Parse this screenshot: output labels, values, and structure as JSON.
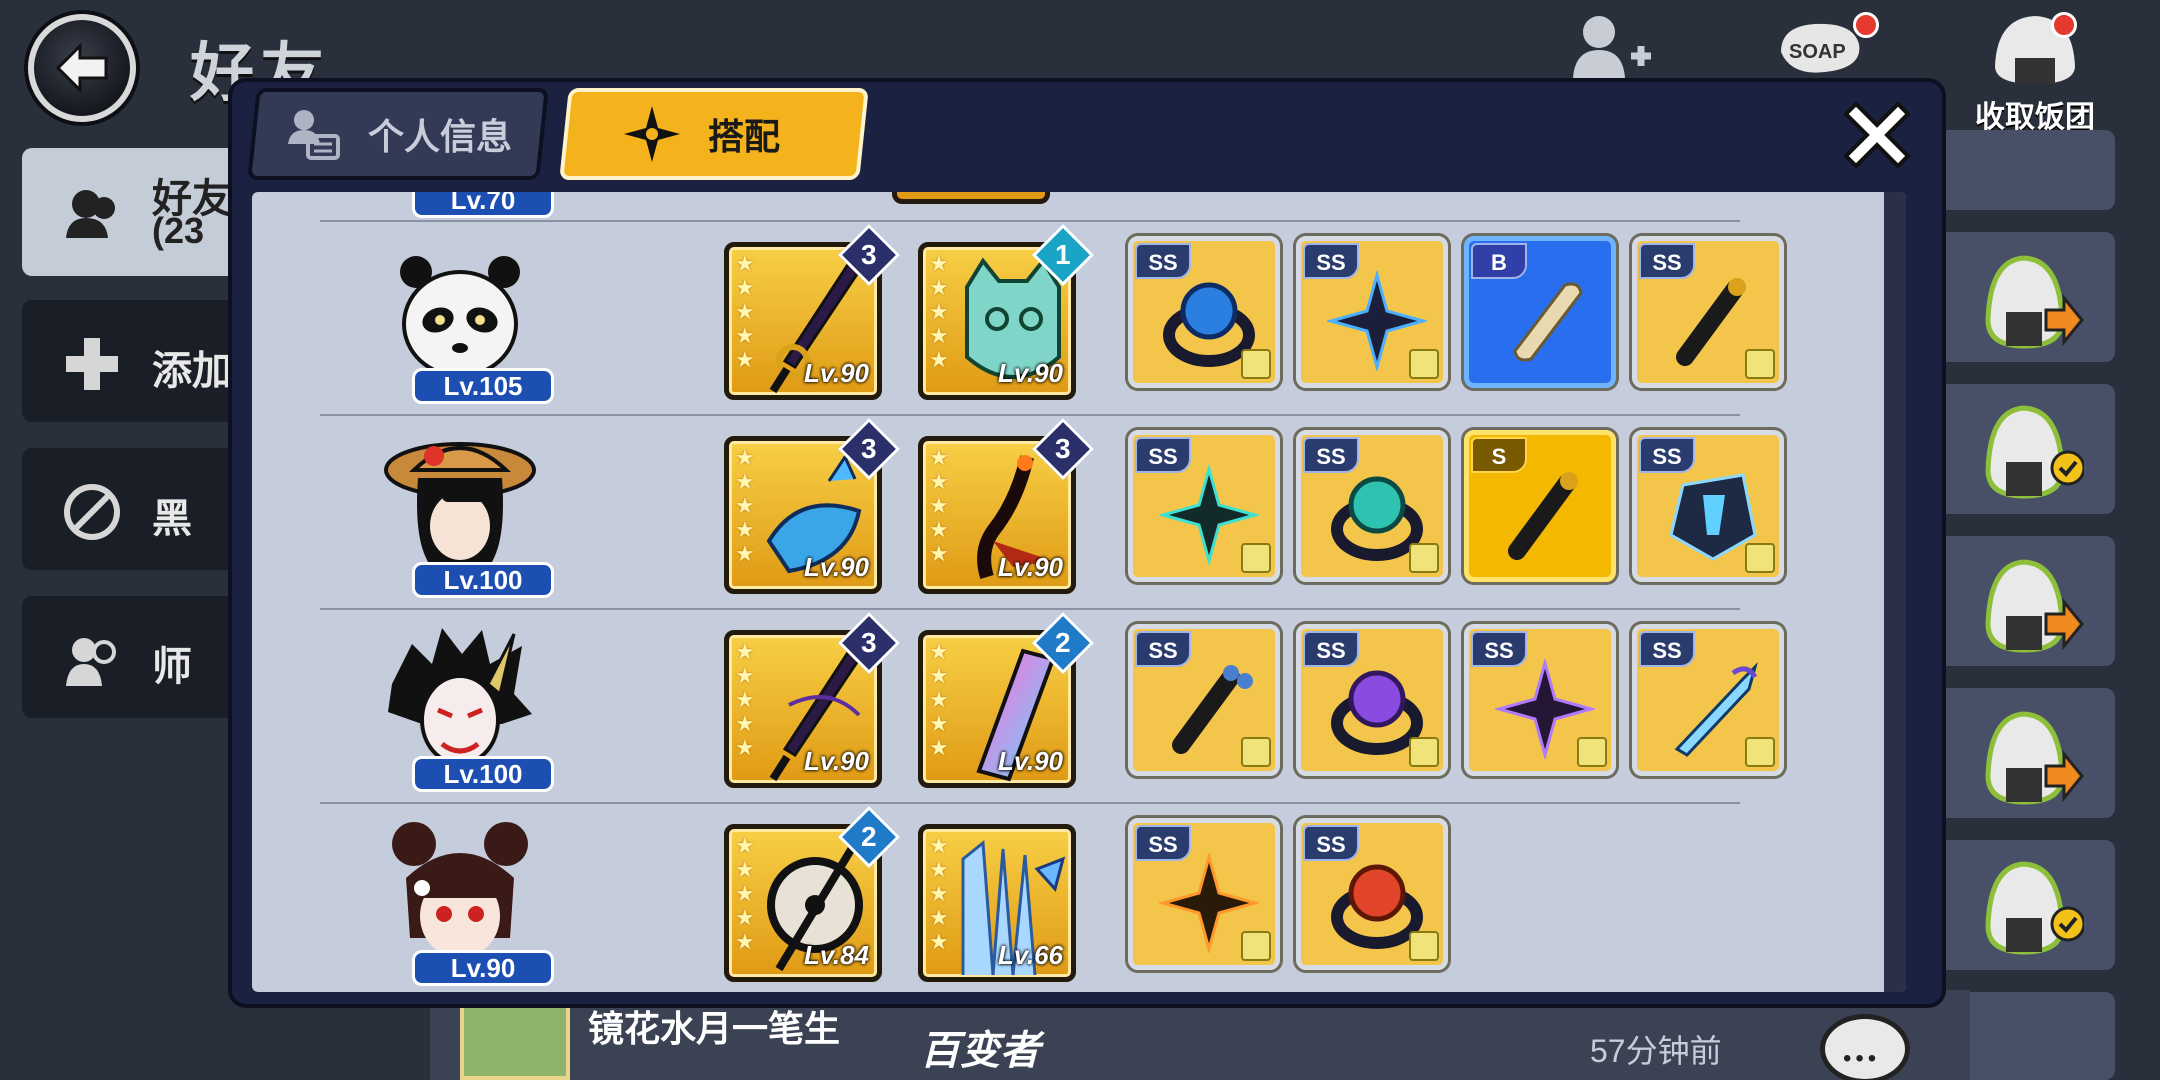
{
  "background": {
    "title": "好友",
    "side": [
      {
        "label": "好友",
        "sub": "(23",
        "icon": "friends-icon"
      },
      {
        "label": "添加",
        "icon": "plus-icon"
      },
      {
        "label": "黑",
        "icon": "block-icon"
      },
      {
        "label": "师",
        "icon": "mentor-icon"
      }
    ],
    "top_right": [
      {
        "icon": "add-friend-icon",
        "label": ""
      },
      {
        "icon": "soap-icon",
        "label": ""
      },
      {
        "icon": "onigiri-icon",
        "label": "收取饭团"
      }
    ],
    "bottom_name": "镜花水月一笔生",
    "bottom_tag": "百变者",
    "bottom_time": "57分钟前"
  },
  "modal": {
    "tabs": [
      {
        "label": "个人信息",
        "active": false,
        "icon": "profile-card-icon"
      },
      {
        "label": "搭配",
        "active": true,
        "icon": "shuriken-icon"
      }
    ],
    "prev_level": "Lv.70",
    "rows": [
      {
        "character": "panda-ninja",
        "level": "Lv.105",
        "weapons": [
          {
            "stars": 5,
            "level": "Lv.90",
            "badge": "3",
            "art": "dark-katana"
          },
          {
            "stars": 5,
            "level": "Lv.90",
            "badge": "1",
            "art": "cat-mask"
          }
        ],
        "scrolls": [
          {
            "grade": "SS",
            "art": "ring-blue"
          },
          {
            "grade": "SS",
            "art": "shuriken-blue"
          },
          {
            "grade": "B",
            "art": "paper-scroll",
            "tier": "blue"
          },
          {
            "grade": "SS",
            "art": "scroll-black"
          }
        ]
      },
      {
        "character": "straw-hat-girl",
        "level": "Lv.100",
        "weapons": [
          {
            "stars": 5,
            "level": "Lv.90",
            "badge": "3",
            "art": "fish-hammer"
          },
          {
            "stars": 5,
            "level": "Lv.90",
            "badge": "3",
            "art": "flame-blade"
          }
        ],
        "scrolls": [
          {
            "grade": "SS",
            "art": "shuriken-teal"
          },
          {
            "grade": "SS",
            "art": "ring-teal"
          },
          {
            "grade": "S",
            "art": "scroll-black",
            "tier": "gold"
          },
          {
            "grade": "SS",
            "art": "crystal-armor"
          }
        ]
      },
      {
        "character": "oni-mask-boy",
        "level": "Lv.100",
        "weapons": [
          {
            "stars": 5,
            "level": "Lv.90",
            "badge": "3",
            "art": "dark-katana"
          },
          {
            "stars": 5,
            "level": "Lv.90",
            "badge": "2",
            "art": "phone-blade"
          }
        ],
        "scrolls": [
          {
            "grade": "SS",
            "art": "scroll-frog"
          },
          {
            "grade": "SS",
            "art": "ring-purple"
          },
          {
            "grade": "SS",
            "art": "shuriken-purple"
          },
          {
            "grade": "SS",
            "art": "crystal-kunai"
          }
        ]
      },
      {
        "character": "bun-hair-girl",
        "level": "Lv.90",
        "weapons": [
          {
            "stars": 5,
            "level": "Lv.84",
            "badge": "2",
            "art": "drum-staff"
          },
          {
            "stars": 5,
            "level": "Lv.66",
            "badge": "",
            "art": "ice-fan"
          }
        ],
        "scrolls": [
          {
            "grade": "SS",
            "art": "shuriken-orange"
          },
          {
            "grade": "SS",
            "art": "ring-red"
          }
        ]
      }
    ]
  },
  "colors": {
    "accent": "#f4b21d",
    "panel": "#c5cddc",
    "modal": "#1b2140",
    "level_pill": "#1d4fb3"
  }
}
